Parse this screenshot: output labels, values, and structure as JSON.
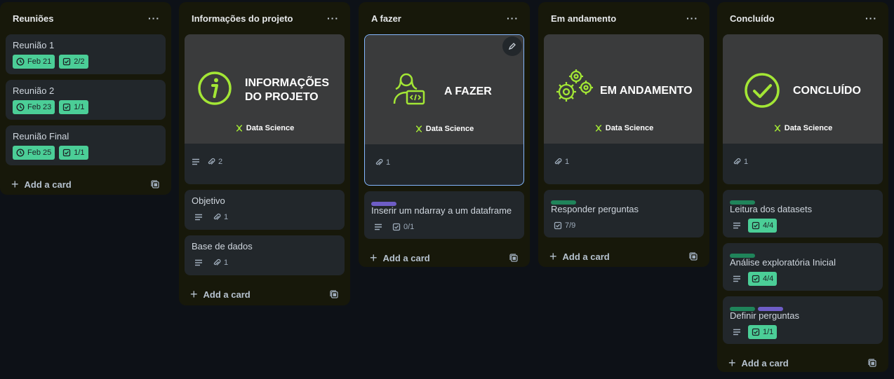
{
  "colors": {
    "accent": "#a3e635",
    "badge_green": "#4bce97",
    "label_purple": "#6e5dc6",
    "label_green": "#1f845a",
    "board_bg": "#0d1117",
    "list_bg": "#17180a",
    "card_bg": "#22272b"
  },
  "brand": "Data Science",
  "add_card_label": "Add a card",
  "lists": [
    {
      "title": "Reuniões",
      "cards": [
        {
          "title": "Reunião 1",
          "date": "Feb 21",
          "checklist": "2/2"
        },
        {
          "title": "Reunião 2",
          "date": "Feb 23",
          "checklist": "1/1"
        },
        {
          "title": "Reunião Final",
          "date": "Feb 25",
          "checklist": "1/1"
        }
      ]
    },
    {
      "title": "Informações do projeto",
      "cover": {
        "line1": "INFORMAÇÕES",
        "line2": "DO PROJETO",
        "icon": "info-circle-icon",
        "attachments": "2"
      },
      "cards": [
        {
          "title": "Objetivo",
          "attachments": "1"
        },
        {
          "title": "Base de dados",
          "attachments": "1"
        }
      ]
    },
    {
      "title": "A fazer",
      "cover": {
        "line1": "A FAZER",
        "icon": "developer-person-icon",
        "attachments": "1"
      },
      "cards": [
        {
          "title": "Inserir um ndarray a um dataframe",
          "checklist": "0/1",
          "labels": [
            "purple"
          ]
        }
      ]
    },
    {
      "title": "Em andamento",
      "cover": {
        "line1": "EM ANDAMENTO",
        "icon": "gears-icon",
        "attachments": "1"
      },
      "cards": [
        {
          "title": "Responder perguntas",
          "checklist": "7/9",
          "labels": [
            "green"
          ]
        }
      ]
    },
    {
      "title": "Concluído",
      "cover": {
        "line1": "CONCLUÍDO",
        "icon": "check-circle-icon",
        "attachments": "1"
      },
      "cards": [
        {
          "title": "Leitura dos datasets",
          "checklist": "4/4",
          "labels": [
            "green"
          ]
        },
        {
          "title": "Análise exploratória Inicial",
          "checklist": "4/4",
          "labels": [
            "green"
          ]
        },
        {
          "title": "Definir perguntas",
          "checklist": "1/1",
          "labels": [
            "green",
            "purple"
          ]
        }
      ]
    }
  ]
}
